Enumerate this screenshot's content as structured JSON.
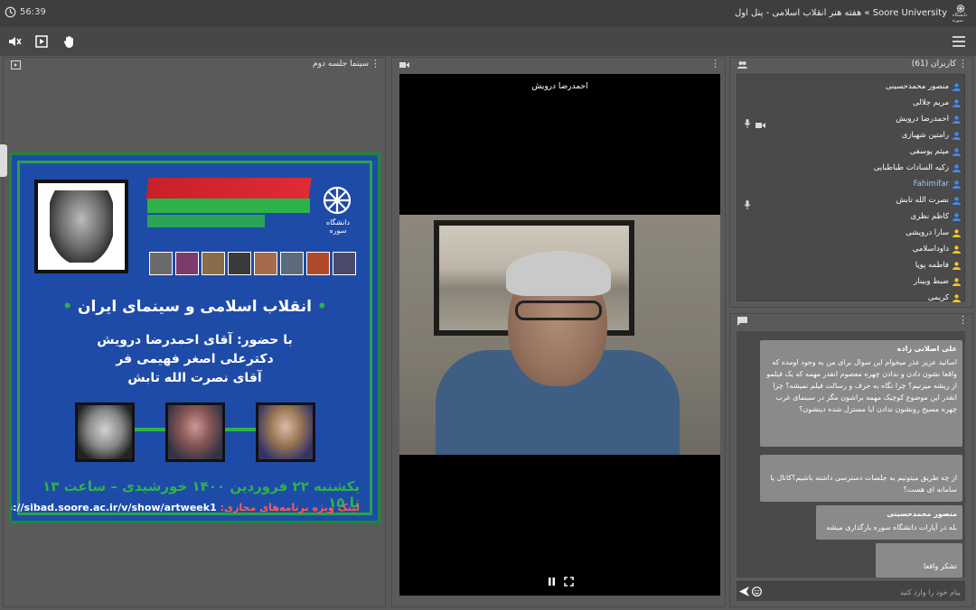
{
  "header": {
    "clock": "56:39",
    "breadcrumb": "Soore University » هفته هنر انقلاب اسلامی - پنل اول",
    "logo_text": "دانشگاه سوره"
  },
  "toolbar": {
    "icons": [
      "mute-icon",
      "play-icon",
      "raise-hand-icon",
      "menu-icon"
    ]
  },
  "presentation_pane": {
    "title": "سینما جلسه دوم"
  },
  "poster": {
    "university_label": "دانشگاه سوره",
    "headline": "انقلاب اسلامی و سینمای ایران",
    "guests_line1": "با حضور: آقای احمدرضا درویش",
    "guests_line2": "دکترعلی اصغر فهیمی فر",
    "guests_line3": "آقای نصرت الله تابش",
    "date_line": "یکشنبه ۲۲ فروردین ۱۴۰۰ خورشیدی – ساعت ۱۳ تا ۱۵",
    "link_label": "لینک ویژه برنامه‌های مجازی:",
    "link_url": "https://sibad.soore.ac.ir/v/show/artweek1",
    "colors": {
      "background": "#1f4ba8",
      "accent_green": "#2db34a",
      "accent_red": "#d42a33"
    }
  },
  "video_pane": {
    "speaker_name": "احمدرضا درویش"
  },
  "users_pane": {
    "title": "کاربران (61)",
    "users": [
      {
        "name": "منصور محمدحسینی",
        "highlight": false,
        "mic": false,
        "cam": false
      },
      {
        "name": "مریم جلالی",
        "highlight": false,
        "mic": false,
        "cam": false
      },
      {
        "name": "احمدرضا درویش",
        "highlight": false,
        "mic": true,
        "cam": true
      },
      {
        "name": "رامتین شهبازی",
        "highlight": false,
        "mic": false,
        "cam": false
      },
      {
        "name": "میثم یوسفی",
        "highlight": false,
        "mic": false,
        "cam": false
      },
      {
        "name": "زکیه السادات طباطبایی",
        "highlight": false,
        "mic": false,
        "cam": false
      },
      {
        "name": "Fahimifar",
        "highlight": true,
        "mic": false,
        "cam": false
      },
      {
        "name": "نصرت الله تابش",
        "highlight": false,
        "mic": true,
        "cam": false
      },
      {
        "name": "کاظم نظری",
        "highlight": false,
        "mic": false,
        "cam": false
      },
      {
        "name": "سارا درویشی",
        "highlight": false,
        "mic": false,
        "cam": false
      },
      {
        "name": "داوداسلامی",
        "highlight": false,
        "mic": false,
        "cam": false
      },
      {
        "name": "فاطمه پویا",
        "highlight": false,
        "mic": false,
        "cam": false
      },
      {
        "name": "ضبط وبینار",
        "highlight": false,
        "mic": false,
        "cam": false
      },
      {
        "name": "کریمی",
        "highlight": false,
        "mic": false,
        "cam": false
      }
    ]
  },
  "chat": {
    "messages": [
      {
        "sender": "علی اصلانی زاده",
        "text": "اساتید عزیز عذر میخوام این سوال برای من به وجود اومده که واقعا نشون دادن و ندادن چهره معصوم انقدر مهمه که یک فیلمو از ریشه میزنیم؟ چرا نگاه به حرف و رسالت فیلم نمیشه؟ چرا انقدر این موضوع کوچیک مهمه براشون مگر در سینمای غرب چهره مسیح رونشون ندادن ایا مستزل شده دینشون؟"
      },
      {
        "sender": "",
        "text": "از چه طریق میتونیم به جلسات دسترسی داشته باشیم؟کانال یا سامانه ای هست؟"
      },
      {
        "sender": "منصور محمدحسینی",
        "text": "بله در آپارات دانشگاه سوره بارگذاری میشه"
      },
      {
        "sender": "",
        "text": "تشکر واقعا"
      }
    ],
    "input_placeholder": "پیام خود را وارد کنید"
  }
}
